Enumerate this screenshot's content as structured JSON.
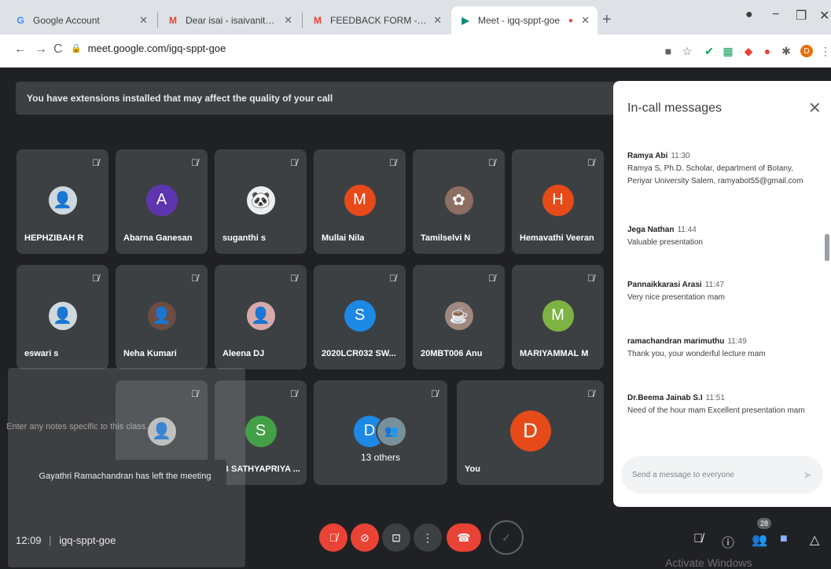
{
  "browser": {
    "tabs": [
      {
        "label": "Google Account",
        "favicon": "G",
        "color": "#4285f4"
      },
      {
        "label": "Dear isai - isaivanitncpbpb@gmail",
        "favicon": "M",
        "color": "#ea4335"
      },
      {
        "label": "FEEDBACK FORM - isaivanitncpb",
        "favicon": "M",
        "color": "#ea4335"
      },
      {
        "label": "Meet - igq-sppt-goe",
        "favicon": "▶",
        "color": "#00897b"
      }
    ],
    "url": "meet.google.com/igq-sppt-goe"
  },
  "banner": {
    "text": "You have extensions installed that may affect the quality of your call"
  },
  "participants_row1": [
    {
      "name": "HEPHZIBAH R",
      "initial": "",
      "color": "#cfd8dc"
    },
    {
      "name": "Abarna Ganesan",
      "initial": "A",
      "color": "#5e35b1"
    },
    {
      "name": "suganthi s",
      "initial": "",
      "color": "#eceff1"
    },
    {
      "name": "Mullai Nila",
      "initial": "M",
      "color": "#e64a19"
    },
    {
      "name": "Tamilselvi N",
      "initial": "",
      "color": "#8d6e63"
    },
    {
      "name": "Hemavathi Veeran",
      "initial": "H",
      "color": "#e64a19"
    }
  ],
  "participants_row2": [
    {
      "name": "eswari s",
      "initial": "",
      "color": "#cfd8dc"
    },
    {
      "name": "Neha Kumari",
      "initial": "",
      "color": "#6d4c41"
    },
    {
      "name": "Aleena DJ",
      "initial": "",
      "color": "#d7a9a9"
    },
    {
      "name": "2020LCR032 SW...",
      "initial": "S",
      "color": "#1e88e5"
    },
    {
      "name": "20MBT006 Anu",
      "initial": "",
      "color": "#a1887f"
    },
    {
      "name": "MARIYAMMAL M",
      "initial": "M",
      "color": "#7cb342"
    }
  ],
  "participants_row3": [
    {
      "name": "",
      "initial": "",
      "color": "#bdbdbd"
    },
    {
      "name": "B SATHYAPRIYA ...",
      "initial": "S",
      "color": "#43a047"
    },
    {
      "name": "13 others",
      "initial": "D",
      "color": "#1e88e5"
    },
    {
      "name": "You",
      "initial": "D",
      "color": "#e64a19"
    }
  ],
  "messages_panel": {
    "title": "In-call messages",
    "messages": [
      {
        "sender": "Ramya Abi",
        "time": "11:30",
        "text": "Ramya S, Ph.D. Scholar, department of Botany, Periyar University Salem, ramyabot55@gmail.com"
      },
      {
        "sender": "Jega Nathan",
        "time": "11:44",
        "text": "Valuable presentation"
      },
      {
        "sender": "Pannaikkarasi Arasi",
        "time": "11:47",
        "text": "Very nice presentation  mam"
      },
      {
        "sender": "ramachandran marimuthu",
        "time": "11:49",
        "text": "Thank you, your wonderful lecture mam"
      },
      {
        "sender": "Dr.Beema Jainab S.I",
        "time": "11:51",
        "text": "Need of the hour mam Excellent presentation mam"
      }
    ],
    "input_placeholder": "Send a message to everyone"
  },
  "overlay": {
    "notes_text": "Enter any notes specific to this class."
  },
  "toast": {
    "text": "Gayathri Ramachandran has left the meeting"
  },
  "bottom": {
    "time": "12:09",
    "meeting_code": "igq-sppt-goe",
    "participant_count": "28"
  },
  "watermark": "Activate Windows"
}
